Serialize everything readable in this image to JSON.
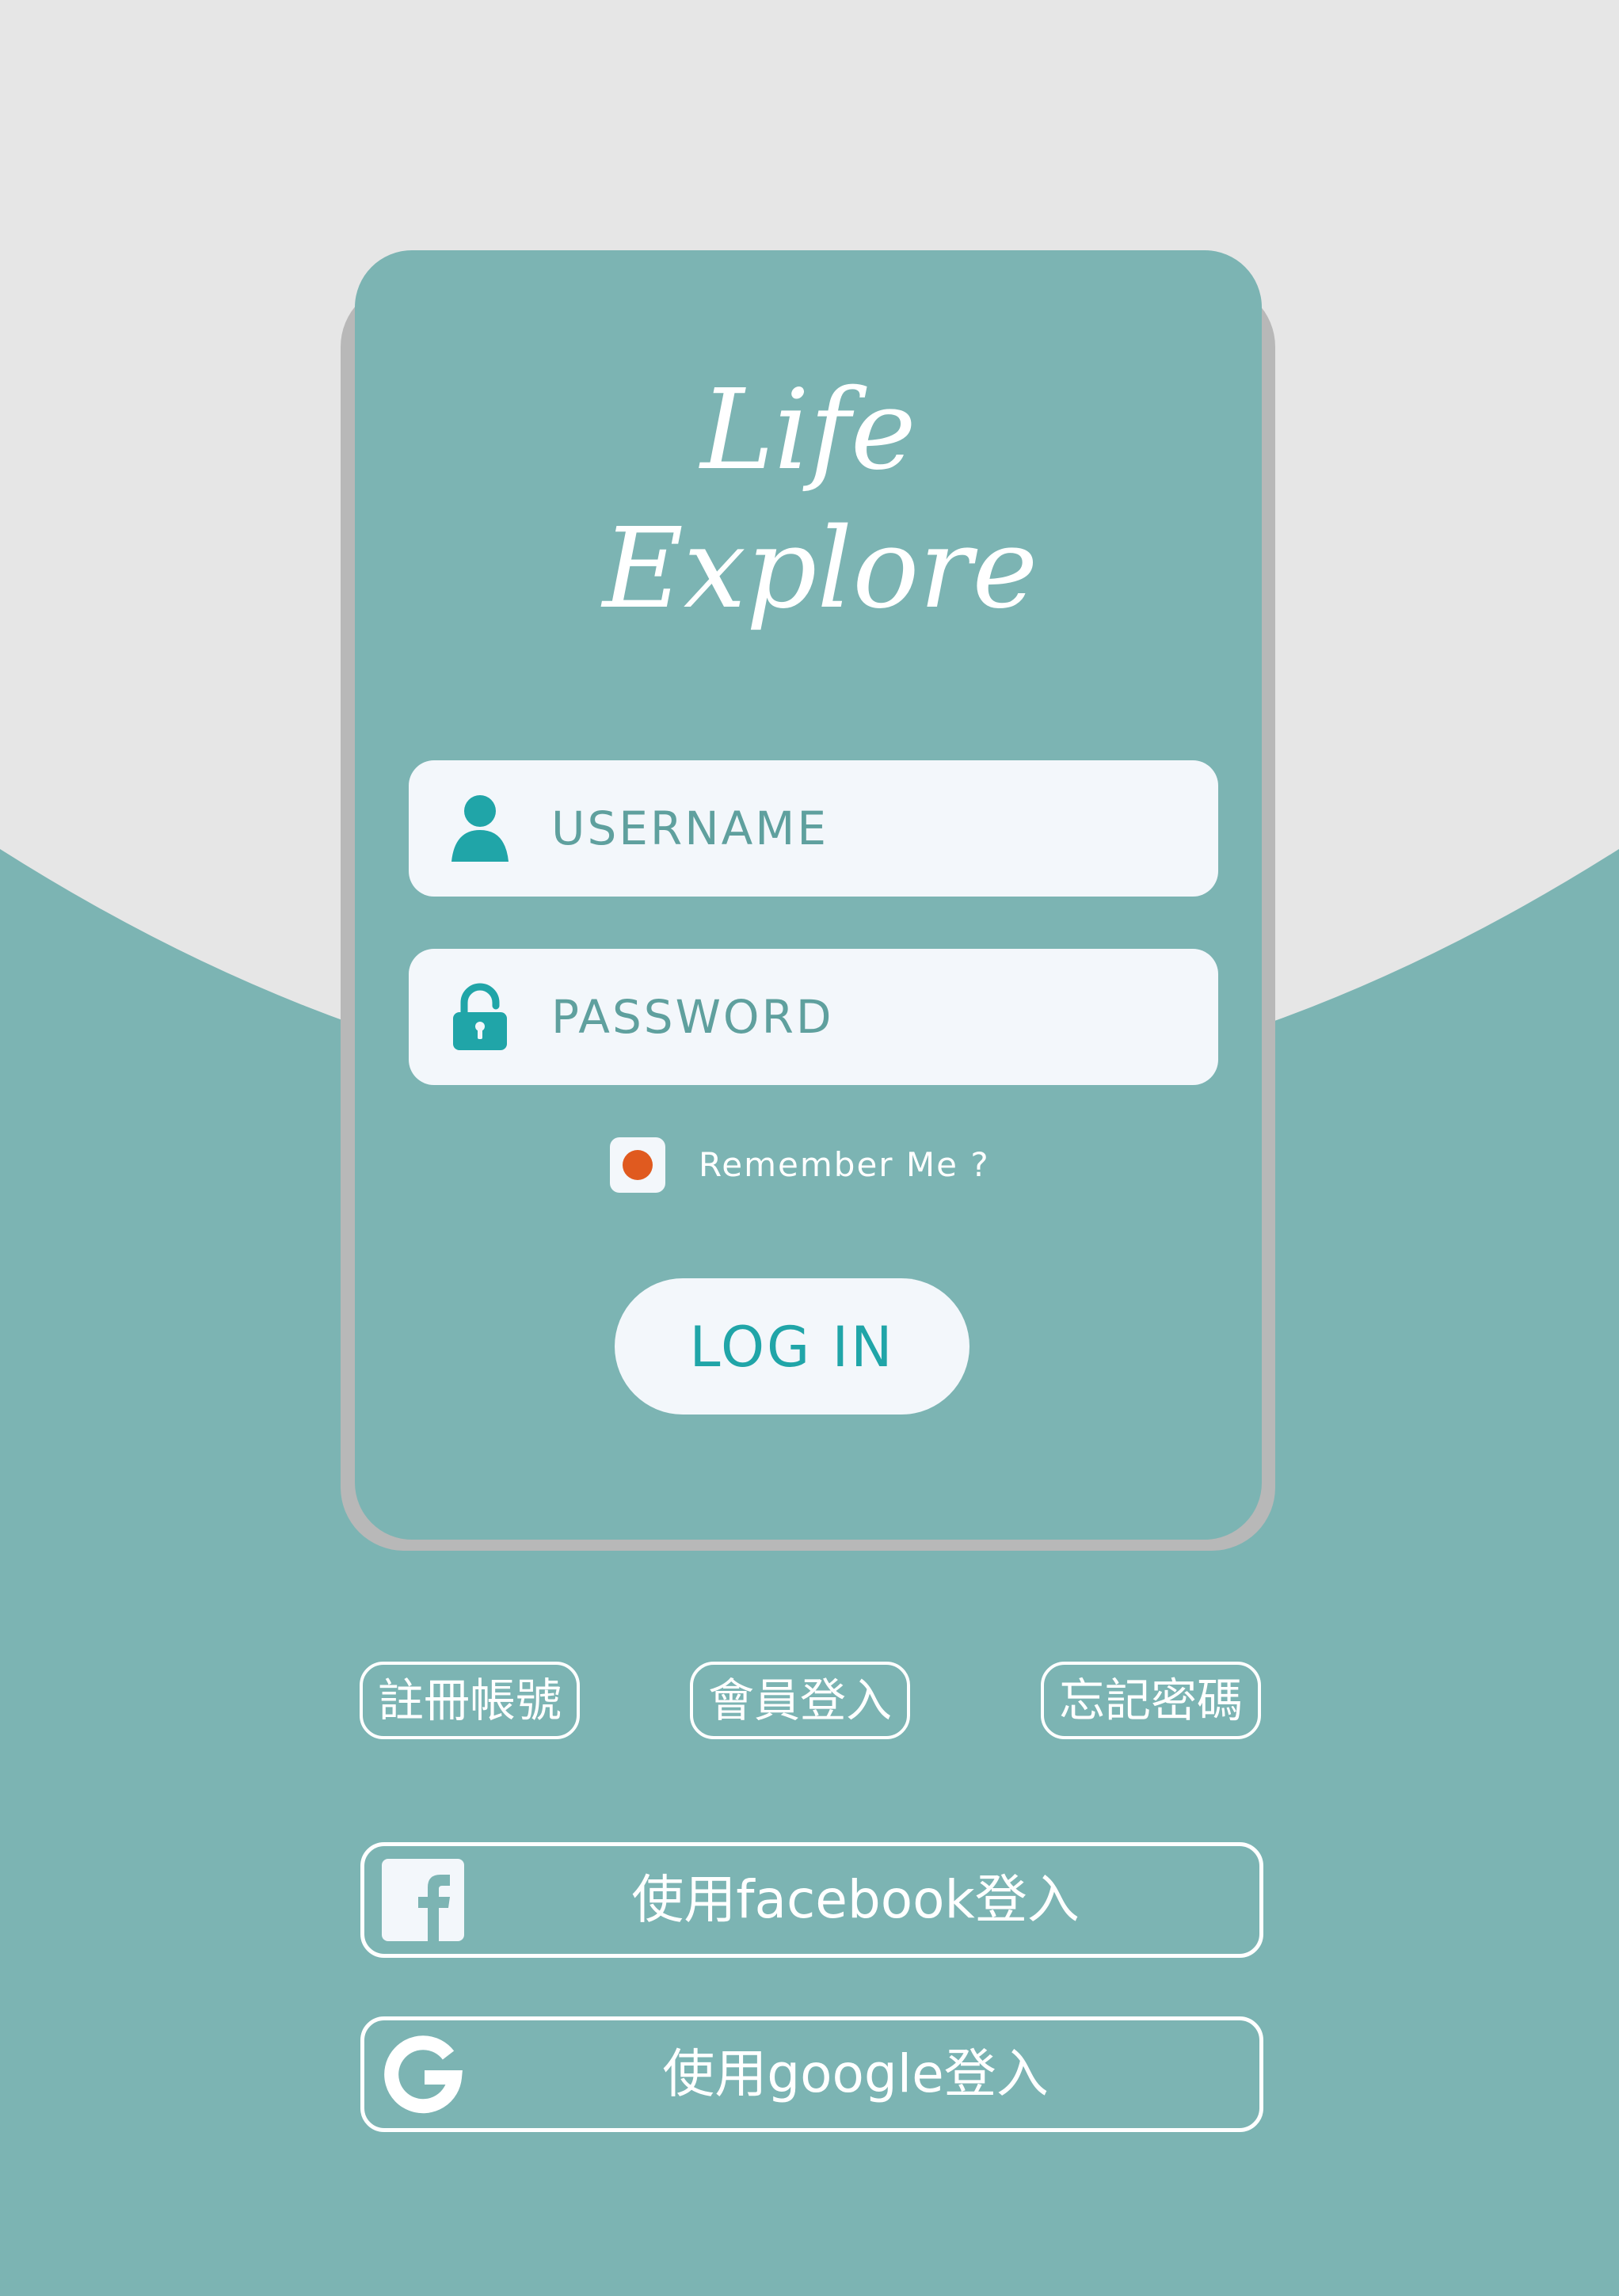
{
  "app": {
    "logo_line1": "Life",
    "logo_line2": "Explore"
  },
  "form": {
    "username_label": "USERNAME",
    "password_label": "PASSWORD",
    "remember_label": "Remember Me ?",
    "remember_checked": true,
    "login_label": "LOG IN"
  },
  "links": {
    "register": "註冊帳號",
    "member_login": "會員登入",
    "forgot_password": "忘記密碼"
  },
  "social": {
    "facebook_label": "使用facebook登入",
    "google_label": "使用google登入"
  },
  "icons": {
    "username": "user-icon",
    "password": "lock-icon",
    "facebook": "facebook-icon",
    "google": "google-icon"
  },
  "colors": {
    "background_teal": "#7cb4b3",
    "background_gray": "#e6e6e6",
    "card_shadow": "#b8b8b8",
    "field_bg": "#f3f7fb",
    "accent_teal": "#20a5a8",
    "checkbox_dot": "#e05a1f",
    "text_white": "#ffffff"
  }
}
